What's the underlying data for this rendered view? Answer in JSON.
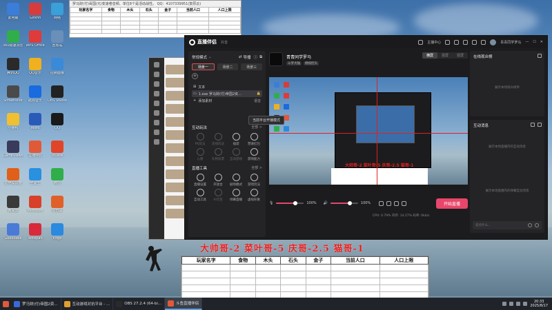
{
  "desktop": {
    "icons": [
      {
        "label": "此电脑",
        "color": "#3b7dd8"
      },
      {
        "label": "Gifxnn",
        "color": "#d83b3b"
      },
      {
        "label": "网络",
        "color": "#3b9fd8"
      },
      {
        "label": "360极速浏览器",
        "color": "#2fae4a"
      },
      {
        "label": "WPS Office",
        "color": "#e03a3a"
      },
      {
        "label": "回收站",
        "color": "#6a8fb8"
      },
      {
        "label": "腾讯QQ",
        "color": "#2a2a2a"
      },
      {
        "label": "QQ音乐",
        "color": "#f0b020"
      },
      {
        "label": "控制面板",
        "color": "#3a8ad8"
      },
      {
        "label": "Screenshot",
        "color": "#4a4a4a"
      },
      {
        "label": "酷狗音乐",
        "color": "#1a6ae0"
      },
      {
        "label": "OBS Studio",
        "color": "#222222"
      },
      {
        "label": "小黄鸭",
        "color": "#f0c030"
      },
      {
        "label": "Word",
        "color": "#2a5ab8"
      },
      {
        "label": "QQ",
        "color": "#1a1a1a"
      },
      {
        "label": "GameViewer",
        "color": "#3a3a5a"
      },
      {
        "label": "直播伴侣",
        "color": "#e05a3a"
      },
      {
        "label": "ToDesk",
        "color": "#e0452a"
      },
      {
        "label": "雷电模拟器",
        "color": "#e0601a"
      },
      {
        "label": "全能王",
        "color": "#2a90e0"
      },
      {
        "label": "微信",
        "color": "#2fae4a"
      },
      {
        "label": "网易云",
        "color": "#3a3a3a"
      },
      {
        "label": "Microsoft",
        "color": "#d8402a"
      },
      {
        "label": "向日葵",
        "color": "#e0602a"
      },
      {
        "label": "GeekBase",
        "color": "#4a7ad8"
      },
      {
        "label": "Notepad",
        "color": "#d82a3a"
      },
      {
        "label": "Edge",
        "color": "#2a8ae0"
      }
    ]
  },
  "top_sheet": {
    "title": "罗马财(付)哥国(元)变速卷音频、单位8个是活动战性。 QQ：4107339951(复原云)",
    "headers": [
      "玩家名字",
      "食物",
      "木头",
      "石头",
      "金子",
      "当前人口",
      "人口上限"
    ]
  },
  "banner": "大帅哥-2  菜叶哥-5  庆哥-2.5  猫哥-1",
  "bottom_sheet": {
    "headers": [
      "玩家名字",
      "食物",
      "木头",
      "石头",
      "金子",
      "当前人口",
      "人口上限"
    ]
  },
  "app": {
    "title": "直播伴侣",
    "subtitle": "抖音",
    "header_right": {
      "live_center": "主播中心",
      "user": "青青同学罗马"
    },
    "mode_select": "常规模式",
    "import_label": "导播",
    "scenes": [
      "场景一",
      "场景二",
      "场景三"
    ],
    "source_header": "文本",
    "sources": [
      "1.exe 罗马财(付)帝国2资...",
      "添加素材"
    ],
    "source_tag": "语音",
    "tooltip": "当前平台开播模式",
    "interactive_title": "互动玩法",
    "interactive_more": "全部 >",
    "interactive_tools": [
      {
        "label": "PK玩法",
        "dim": true
      },
      {
        "label": "连线玩法",
        "dim": true
      },
      {
        "label": "福袋",
        "dim": false
      },
      {
        "label": "营收红包",
        "dim": false
      },
      {
        "label": "心愿",
        "dim": true
      },
      {
        "label": "礼物投票",
        "dim": true
      },
      {
        "label": "互动游戏",
        "dim": true
      },
      {
        "label": "游戏能力",
        "dim": false
      }
    ],
    "live_tools_title": "直播工具",
    "live_tools_more": "全部 >",
    "live_tools": [
      {
        "label": "直播设置",
        "dim": false
      },
      {
        "label": "开放台",
        "dim": false
      },
      {
        "label": "剧场模式",
        "dim": false
      },
      {
        "label": "游戏玩法",
        "dim": false
      },
      {
        "label": "互动工具",
        "dim": false
      },
      {
        "label": "AI可见",
        "dim": true
      },
      {
        "label": "绿幕直播",
        "dim": false
      },
      {
        "label": "虚拟形象",
        "dim": false
      }
    ],
    "streamer_name": "青青同学罗马",
    "streamer_tags": [
      "斗罗大陆",
      "继续控头"
    ],
    "orientation": [
      "横屏",
      "竖屏",
      "竖屏"
    ],
    "volume_mic": "100%",
    "volume_speaker": "100%",
    "volume_mic_value": 0.7,
    "volume_speaker_value": 0.7,
    "start_button": "开始直播",
    "status_text": "CPU: 0.79%   内存: 14.27%   码率: 0kb/s",
    "audience_title": "在线观众榜",
    "audience_empty": "展示本场观众榜单",
    "messages_title": "互动消息",
    "messages_empty_1": "展示本场直播内的互动消息",
    "messages_empty_2": "展示本场直播内的弹幕互动消息",
    "chat_placeholder": "说点什么..."
  },
  "taskbar": {
    "tasks": [
      "罗马财(付)帝国2资...",
      "互动游戏对抗平台 - ...",
      "OBS 27.2.4 (64-bi...",
      "斗鱼直播伴侣"
    ],
    "time": "20:33",
    "date": "2025/8/17"
  }
}
